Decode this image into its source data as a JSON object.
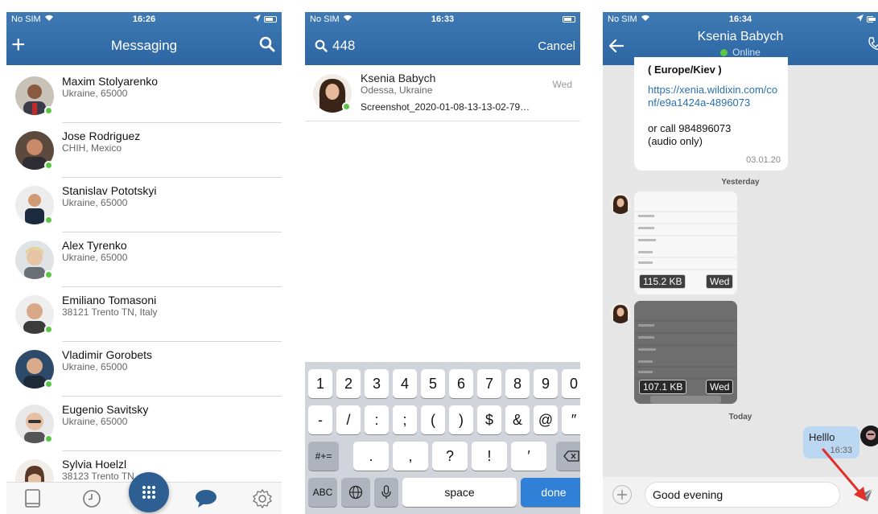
{
  "screen1": {
    "status": {
      "carrier": "No SIM",
      "time": "16:26"
    },
    "title": "Messaging",
    "contacts": [
      {
        "name": "Maxim Stolyarenko",
        "location": "Ukraine, 65000"
      },
      {
        "name": "Jose Rodriguez",
        "location": "CHIH, Mexico"
      },
      {
        "name": "Stanislav Pototskyi",
        "location": "Ukraine, 65000"
      },
      {
        "name": "Alex Tyrenko",
        "location": "Ukraine, 65000"
      },
      {
        "name": "Emiliano Tomasoni",
        "location": "38121 Trento TN, Italy"
      },
      {
        "name": "Vladimir Gorobets",
        "location": "Ukraine, 65000"
      },
      {
        "name": "Eugenio Savitsky",
        "location": "Ukraine, 65000"
      },
      {
        "name": "Sylvia Hoelzl",
        "location": "38123 Trento TN"
      }
    ]
  },
  "screen2": {
    "status": {
      "carrier": "No SIM",
      "time": "16:33"
    },
    "search": {
      "query": "448",
      "cancel_label": "Cancel"
    },
    "result": {
      "name": "Ksenia Babych",
      "location": "Odessa, Ukraine",
      "message": "Screenshot_2020-01-08-13-13-02-79…",
      "when": "Wed"
    },
    "keyboard": {
      "row1": [
        "1",
        "2",
        "3",
        "4",
        "5",
        "6",
        "7",
        "8",
        "9",
        "0"
      ],
      "row2": [
        "-",
        "/",
        ":",
        ";",
        "(",
        ")",
        "$",
        "&",
        "@",
        "″"
      ],
      "row3": [
        "#+=",
        ".",
        ",",
        "?",
        "!",
        "′"
      ],
      "row4": [
        "ABC",
        "space",
        "done"
      ]
    }
  },
  "screen3": {
    "status": {
      "carrier": "No SIM",
      "time": "16:34"
    },
    "contact_name": "Ksenia Babych",
    "presence": "Online",
    "messages": {
      "tz_fragment": "( Europe/Kiev )",
      "link": "https://xenia.wildixin.com/conf/e9a1424a-4896073",
      "call_line_1": "or call 984896073",
      "call_line_2": "(audio only)",
      "date": "03.01.20",
      "yesterday_label": "Yesterday",
      "image1_size": "115.2 KB",
      "image1_day": "Wed",
      "image2_size": "107.1 KB",
      "image2_day": "Wed",
      "today_label": "Today",
      "outgoing_text": "Helllo",
      "outgoing_time": "16:33"
    },
    "composer": {
      "text": "Good evening"
    }
  },
  "colors": {
    "brand": "#3470ad",
    "online": "#5bc544",
    "annotation_arrow": "#e0312a"
  }
}
